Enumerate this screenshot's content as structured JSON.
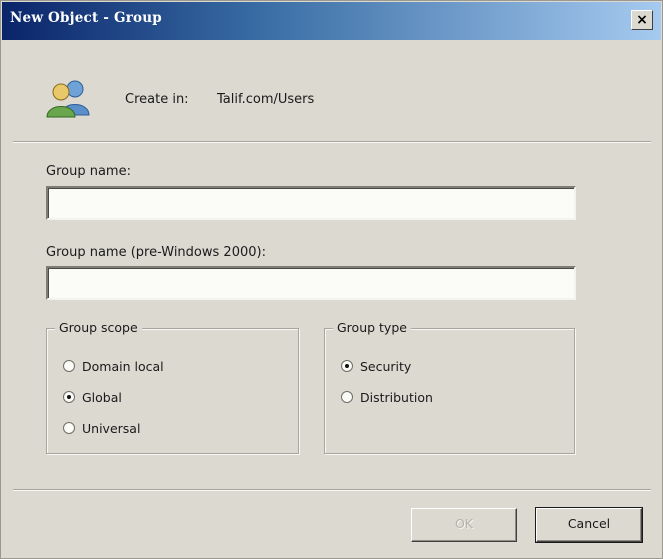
{
  "window": {
    "title": "New Object - Group",
    "close_glyph": "×"
  },
  "header": {
    "icon": "group-users-icon",
    "create_in_label": "Create in:",
    "create_in_value": "Talif.com/Users"
  },
  "form": {
    "group_name_label": "Group name:",
    "group_name_value": "",
    "group_name_pre2000_label": "Group name (pre-Windows 2000):",
    "group_name_pre2000_value": ""
  },
  "group_scope": {
    "legend": "Group scope",
    "options": [
      {
        "label": "Domain local",
        "selected": false
      },
      {
        "label": "Global",
        "selected": true
      },
      {
        "label": "Universal",
        "selected": false
      }
    ]
  },
  "group_type": {
    "legend": "Group type",
    "options": [
      {
        "label": "Security",
        "selected": true
      },
      {
        "label": "Distribution",
        "selected": false
      }
    ]
  },
  "buttons": {
    "ok": "OK",
    "cancel": "Cancel"
  }
}
